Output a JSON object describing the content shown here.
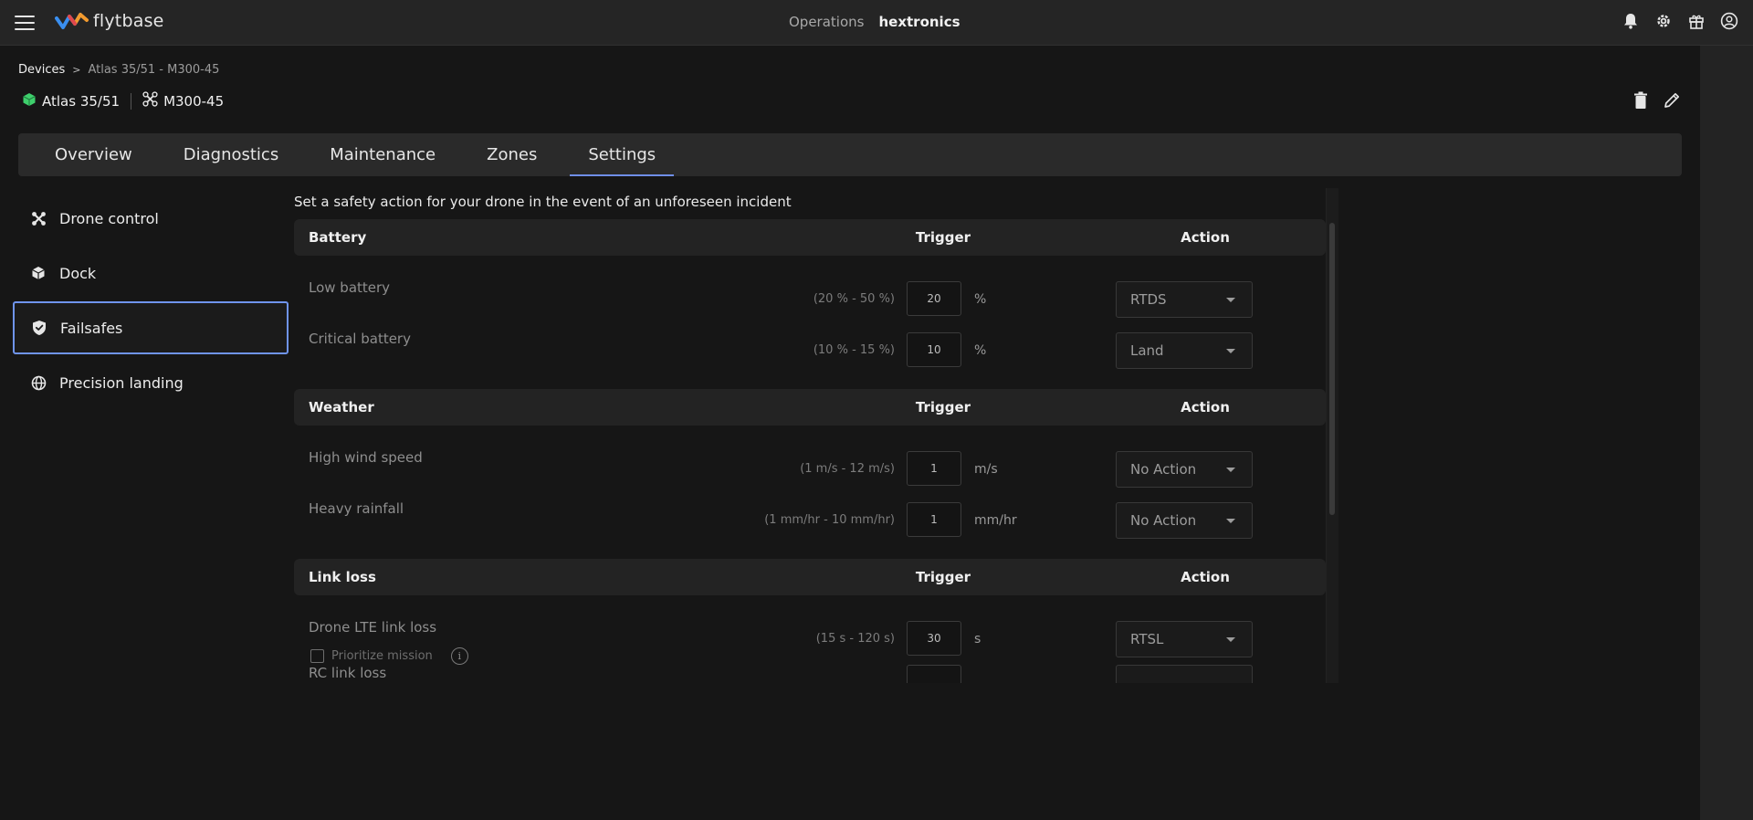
{
  "topbar": {
    "logo_text": "flytbase",
    "operations_label": "Operations",
    "org_name": "hextronics",
    "icons": [
      "bell-icon",
      "gear-icon",
      "gift-icon",
      "user-circle-icon"
    ]
  },
  "breadcrumb": {
    "root": "Devices",
    "separator": ">",
    "current": "Atlas 35/51 - M300-45"
  },
  "device": {
    "dock_name": "Atlas 35/51",
    "drone_name": "M300-45",
    "dock_icon_color": "#3ecf6c"
  },
  "tabs": [
    {
      "label": "Overview"
    },
    {
      "label": "Diagnostics"
    },
    {
      "label": "Maintenance"
    },
    {
      "label": "Zones"
    },
    {
      "label": "Settings",
      "active": true
    }
  ],
  "sidenav": [
    {
      "label": "Drone control",
      "icon": "drone-icon"
    },
    {
      "label": "Dock",
      "icon": "cube-icon"
    },
    {
      "label": "Failsafes",
      "icon": "shield-check-icon",
      "active": true
    },
    {
      "label": "Precision landing",
      "icon": "globe-icon"
    }
  ],
  "content": {
    "intro": "Set a safety action for your drone in the event of an unforeseen incident",
    "trigger_header": "Trigger",
    "action_header": "Action",
    "battery": {
      "title": "Battery",
      "rows": [
        {
          "label": "Low battery",
          "range": "(20 % - 50 %)",
          "value": "20",
          "unit": "%",
          "action": "RTDS"
        },
        {
          "label": "Critical battery",
          "range": "(10 % - 15 %)",
          "value": "10",
          "unit": "%",
          "action": "Land"
        }
      ]
    },
    "weather": {
      "title": "Weather",
      "rows": [
        {
          "label": "High wind speed",
          "range": "(1 m/s - 12 m/s)",
          "value": "1",
          "unit": "m/s",
          "action": "No Action"
        },
        {
          "label": "Heavy rainfall",
          "range": "(1 mm/hr - 10 mm/hr)",
          "value": "1",
          "unit": "mm/hr",
          "action": "No Action"
        }
      ]
    },
    "linkloss": {
      "title": "Link loss",
      "rows": [
        {
          "label": "Drone LTE link loss",
          "range": "(15 s - 120 s)",
          "value": "30",
          "unit": "s",
          "action": "RTSL",
          "checkbox_label": "Prioritize mission",
          "info": "i"
        },
        {
          "label": "RC link loss"
        }
      ]
    }
  },
  "colors": {
    "accent": "#6f94ec",
    "background": "#161616",
    "topbar": "#252525"
  }
}
